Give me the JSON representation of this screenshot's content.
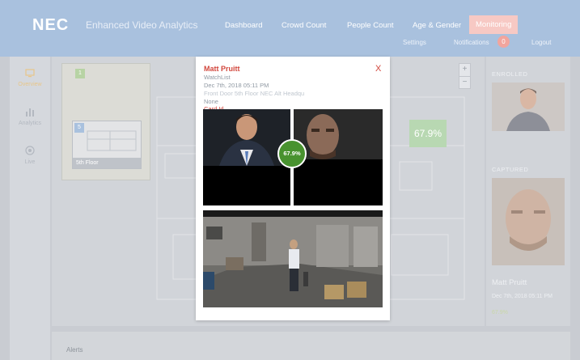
{
  "header": {
    "logo": "NEC",
    "app_title": "Enhanced Video Analytics",
    "nav": [
      "Dashboard",
      "Crowd Count",
      "People Count",
      "Age & Gender",
      "Monitoring"
    ],
    "active_nav": "Monitoring",
    "settings": "Settings",
    "notifications": "Notifications",
    "notification_count": "0",
    "logout": "Logout"
  },
  "sidebar": {
    "items": [
      {
        "label": "Overview",
        "icon": "monitor-icon"
      },
      {
        "label": "Analytics",
        "icon": "bar-chart-icon"
      },
      {
        "label": "Live",
        "icon": "camera-icon"
      }
    ]
  },
  "minimap": {
    "marker_1": "1",
    "marker_2": "5",
    "floor_label": "5th Floor"
  },
  "zoom": {
    "plus": "+",
    "minus": "−"
  },
  "match_tag": "67.9%",
  "popup": {
    "name": "Matt Pruitt",
    "list": "WatchList",
    "date": "Dec 7th, 2018 05:11 PM",
    "location": "Front Door 5th Floor NEC Alt Headqu",
    "status": "None",
    "card": "Card Id",
    "close": "X",
    "score": "67.9%"
  },
  "right_panel": {
    "enrolled_label": "ENROLLED",
    "captured_label": "CAPTURED",
    "name": "Matt Pruitt",
    "date": "Dec 7th, 2018 05:11 PM",
    "score": "67.9%"
  },
  "alerts": {
    "label": "Alerts"
  },
  "colors": {
    "header": "#a9c1de",
    "accent_red": "#d2473d",
    "match_green": "#48922f"
  }
}
